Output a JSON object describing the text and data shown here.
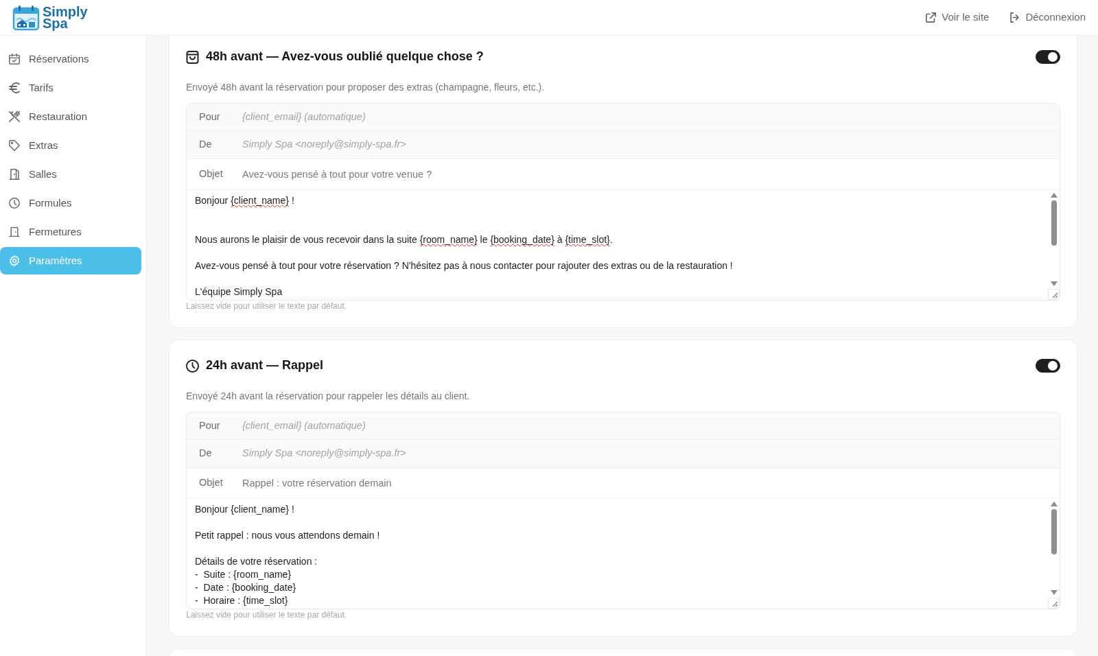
{
  "header": {
    "logo_text": [
      "Simply",
      "Spa"
    ],
    "links": [
      "Voir le site",
      "Déconnexion"
    ]
  },
  "sidebar": {
    "items": [
      {
        "label": "Réservations",
        "selected": false
      },
      {
        "label": "Tarifs",
        "selected": false
      },
      {
        "label": "Restauration",
        "selected": false
      },
      {
        "label": "Extras",
        "selected": false
      },
      {
        "label": "Salles",
        "selected": false
      },
      {
        "label": "Formules",
        "selected": false
      },
      {
        "label": "Fermetures",
        "selected": false
      },
      {
        "label": "Paramètres",
        "selected": true
      }
    ]
  },
  "emails": [
    {
      "title": "48h avant — Avez-vous oublié quelque chose ?",
      "enabled": true,
      "description": "Envoyé 48h avant la réservation pour proposer des extras (champagne, fleurs, etc.).",
      "fields": [
        {
          "label": "Pour",
          "kind": "readonly",
          "value": "{client_email} (automatique)"
        },
        {
          "label": "De",
          "kind": "readonly",
          "value": "Simply Spa <noreply@simply-spa.fr>"
        },
        {
          "label": "Objet",
          "kind": "input",
          "placeholder": "Avez-vous pensé à tout pour votre venue ?"
        }
      ],
      "body": [
        {
          "text": "Bonjour ",
          "spellcheck_error": false
        },
        {
          "text": "{client_name}",
          "spellcheck_error": true
        },
        {
          "text": " !\n\n\nNous aurons le plaisir de vous recevoir dans la suite ",
          "spellcheck_error": false
        },
        {
          "text": "{room_name}",
          "spellcheck_error": true
        },
        {
          "text": " le ",
          "spellcheck_error": false
        },
        {
          "text": "{booking_date}",
          "spellcheck_error": true
        },
        {
          "text": " à ",
          "spellcheck_error": false
        },
        {
          "text": "{time_slot}",
          "spellcheck_error": true
        },
        {
          "text": ".\n\nAvez-vous pensé à tout pour votre réservation ? N'hésitez pas à nous contacter pour rajouter des extras ou de la restauration !\n\nL'équipe Simply Spa",
          "spellcheck_error": false
        }
      ],
      "hint": "Laissez vide pour utiliser le texte par défaut."
    },
    {
      "title": "24h avant — Rappel",
      "enabled": true,
      "description": "Envoyé 24h avant la réservation pour rappeler les détails au client.",
      "fields": [
        {
          "label": "Pour",
          "kind": "readonly",
          "value": "{client_email} (automatique)"
        },
        {
          "label": "De",
          "kind": "readonly",
          "value": "Simply Spa <noreply@simply-spa.fr>"
        },
        {
          "label": "Objet",
          "kind": "input",
          "placeholder": "Rappel : votre réservation demain"
        }
      ],
      "body": [
        {
          "text": "Bonjour {client_name} !\n\nPetit rappel : nous vous attendons demain !\n\nDétails de votre réservation :\n-  Suite : {room_name}\n-  Date : {booking_date}\n-  Horaire : {time_slot}",
          "spellcheck_error": false
        }
      ],
      "hint": "Laissez vide pour utiliser le texte par défaut."
    }
  ]
}
